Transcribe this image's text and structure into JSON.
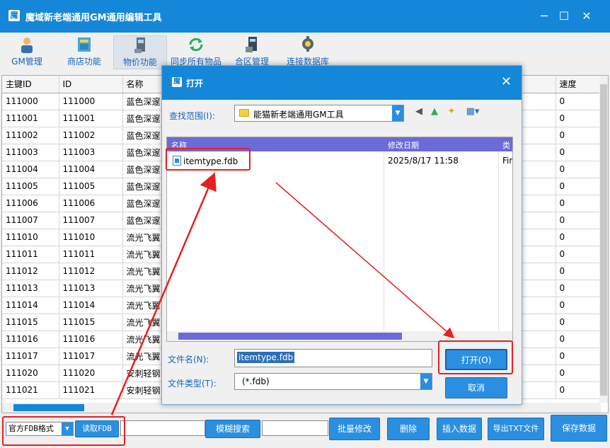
{
  "window": {
    "title": "魔域新老端通用GM通用编辑工具",
    "minimize": "─",
    "maximize": "☐",
    "close": "✕"
  },
  "toolbar": {
    "items": [
      {
        "label": "GM管理",
        "icon": "user-icon"
      },
      {
        "label": "商店功能",
        "icon": "shop-icon"
      },
      {
        "label": "物价功能",
        "icon": "computer-icon",
        "active": true
      },
      {
        "label": "同步所有物品",
        "icon": "sync-icon"
      },
      {
        "label": "合区管理",
        "icon": "merge-icon"
      },
      {
        "label": "连接数据库",
        "icon": "database-icon"
      }
    ]
  },
  "grid": {
    "columns": [
      "主键ID",
      "ID",
      "名称",
      "速度"
    ],
    "rows": [
      [
        "111000",
        "111000",
        "蓝色深邃",
        "0"
      ],
      [
        "111001",
        "111001",
        "蓝色深邃",
        "0"
      ],
      [
        "111002",
        "111002",
        "蓝色深邃",
        "0"
      ],
      [
        "111003",
        "111003",
        "蓝色深邃",
        "0"
      ],
      [
        "111004",
        "111004",
        "蓝色深邃",
        "0"
      ],
      [
        "111005",
        "111005",
        "蓝色深邃",
        "0"
      ],
      [
        "111006",
        "111006",
        "蓝色深邃",
        "0"
      ],
      [
        "111007",
        "111007",
        "蓝色深邃",
        "0"
      ],
      [
        "111010",
        "111010",
        "流光飞翼",
        "0"
      ],
      [
        "111011",
        "111011",
        "流光飞翼",
        "0"
      ],
      [
        "111012",
        "111012",
        "流光飞翼",
        "0"
      ],
      [
        "111013",
        "111013",
        "流光飞翼",
        "0"
      ],
      [
        "111014",
        "111014",
        "流光飞翼",
        "0"
      ],
      [
        "111015",
        "111015",
        "流光飞翼",
        "0"
      ],
      [
        "111016",
        "111016",
        "流光飞翼",
        "0"
      ],
      [
        "111017",
        "111017",
        "流光飞翼",
        "0"
      ],
      [
        "111020",
        "111020",
        "安刺轻钢",
        "0"
      ],
      [
        "111021",
        "111021",
        "安刺轻钢",
        "0"
      ]
    ]
  },
  "bottom": {
    "format_select": "官方FDB格式",
    "read_fdb": "读取FDB",
    "fuzzy_search": "模糊搜索",
    "batch_edit": "批量修改",
    "delete": "删除",
    "insert": "插入数据",
    "export_txt": "导出TXT文件",
    "save": "保存数据"
  },
  "dialog": {
    "title": "打开",
    "look_in_label": "查找范围(I):",
    "look_in_value": "能猫新老端通用GM工具",
    "col_name": "名称",
    "col_date": "修改日期",
    "col_type": "类",
    "files": [
      {
        "name": "itemtype.fdb",
        "date": "2025/8/17 11:58",
        "type": "Fir"
      }
    ],
    "filename_label": "文件名(N):",
    "filename_value": "itemtype.fdb",
    "filetype_label": "文件类型(T):",
    "filetype_value": "(*.fdb)",
    "open_button": "打开(O)",
    "cancel_button": "取消"
  },
  "colors": {
    "title_bar": "#1587d8",
    "button": "#2a8fe0",
    "annotation_red": "#e52020"
  }
}
